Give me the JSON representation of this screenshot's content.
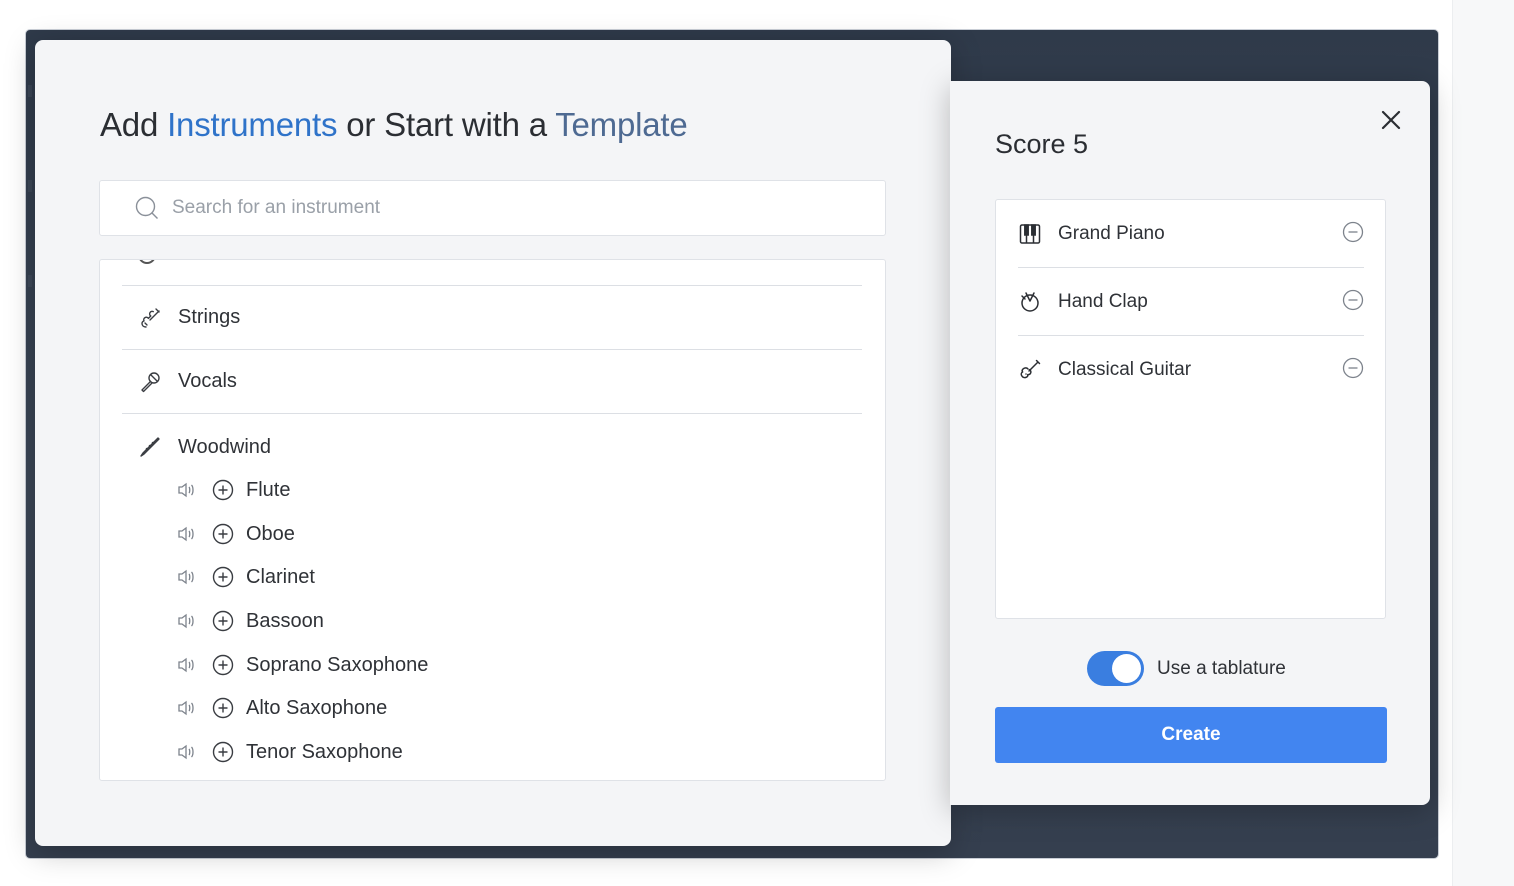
{
  "dialog": {
    "title_prefix": "Add ",
    "title_link_instruments": "Instruments",
    "title_middle": " or Start with a ",
    "title_link_template": "Template",
    "search_placeholder": "Search for an instrument",
    "categories": [
      {
        "label": "Strings",
        "icon": "violin-icon"
      },
      {
        "label": "Vocals",
        "icon": "microphone-icon"
      },
      {
        "label": "Woodwind",
        "icon": "clarinet-icon"
      }
    ],
    "woodwind_instruments": [
      "Flute",
      "Oboe",
      "Clarinet",
      "Bassoon",
      "Soprano Saxophone",
      "Alto Saxophone",
      "Tenor Saxophone"
    ]
  },
  "score": {
    "title": "Score 5",
    "instruments": [
      {
        "label": "Grand Piano",
        "icon": "piano-keys-icon"
      },
      {
        "label": "Hand Clap",
        "icon": "drum-icon"
      },
      {
        "label": "Classical Guitar",
        "icon": "guitar-icon"
      }
    ],
    "tablature_label": "Use a tablature",
    "tablature_enabled": true,
    "create_label": "Create"
  },
  "colors": {
    "accent": "#4285f0",
    "title_link": "#2f73c9",
    "title_link_secondary": "#4e6a92",
    "toggle_on": "#3a7ee0"
  }
}
